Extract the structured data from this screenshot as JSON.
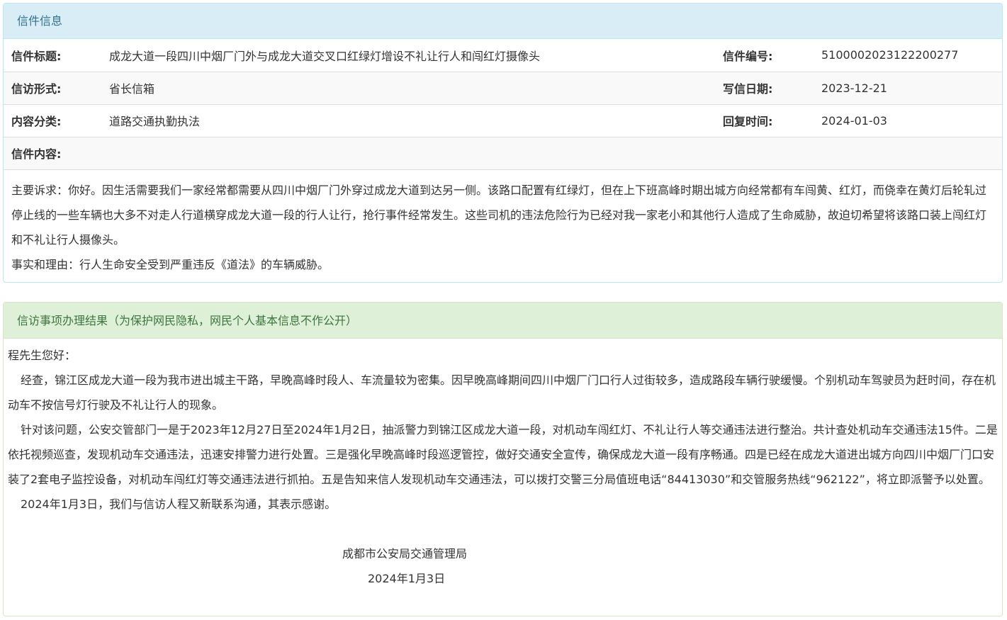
{
  "letter_info": {
    "heading": "信件信息",
    "rows": [
      {
        "label1": "信件标题:",
        "value1": "成龙大道一段四川中烟厂门外与成龙大道交叉口红绿灯增设不礼让行人和闯红灯摄像头",
        "label2": "信件编号:",
        "value2": "510000202312220027​7"
      },
      {
        "label1": "信访形式:",
        "value1": "省长信箱",
        "label2": "写信日期:",
        "value2": "2023-12-21"
      },
      {
        "label1": "内容分类:",
        "value1": "道路交通执勤执法",
        "label2": "回复时间:",
        "value2": "2024-01-03"
      }
    ],
    "content_label": "信件内容:",
    "content_paragraphs": [
      "主要诉求：你好。因生活需要我们一家经常都需要从四川中烟厂门外穿过成龙大道到达另一侧。该路口配置有红绿灯，但在上下班高峰时期出城方向经常都有车闯黄、红灯，而侥幸在黄灯后轮轧过停止线的一些车辆也大多不对走人行道横穿成龙大道一段的行人让行，抢行事件经常发生。这些司机的违法危险行为已经对我一家老小和其他行人造成了生命威胁，故迫切希望将该路口装上闯红灯和不礼让行人摄像头。",
      "事实和理由：行人生命安全受到严重违反《道法》的车辆威胁。"
    ]
  },
  "result": {
    "heading": "信访事项办理结果（为保护网民隐私，网民个人基本信息不作公开）",
    "greeting": "程先生您好：",
    "paragraphs": [
      "经查，锦江区成龙大道一段为我市进出城主干路，早晚高峰时段人、车流量较为密集。因早晚高峰期间四川中烟厂门口行人过街较多，造成路段车辆行驶缓慢。个别机动车驾驶员为赶时间，存在机动车不按信号灯行驶及不礼让行人的现象。",
      "针对该问题，公安交管部门一是于2023年12月27日至2024年1月2日，抽派警力到锦江区成龙大道一段，对机动车闯红灯、不礼让行人等交通违法进行整治。共计查处机动车交通违法15件。二是依托视频巡查，发现机动车交通违法，迅速安排警力进行处置。三是强化早晚高峰时段巡逻管控，做好交通安全宣传，确保成龙大道一段有序畅通。四是已经在成龙大道进出城方向四川中烟厂门口安装了2套电子监控设备，对机动车闯红灯等交通违法进行抓拍。五是告知来信人发现机动车交通违法，可以拨打交警三分局值班电话“84413030”和交管服务热线“962122”，将立即派警予以处置。",
      "2024年1月3日，我们与信访人程又新联系沟通，其表示感谢。"
    ],
    "signature_org": "成都市公安局交通管理局",
    "signature_date": "2024年1月3日"
  }
}
